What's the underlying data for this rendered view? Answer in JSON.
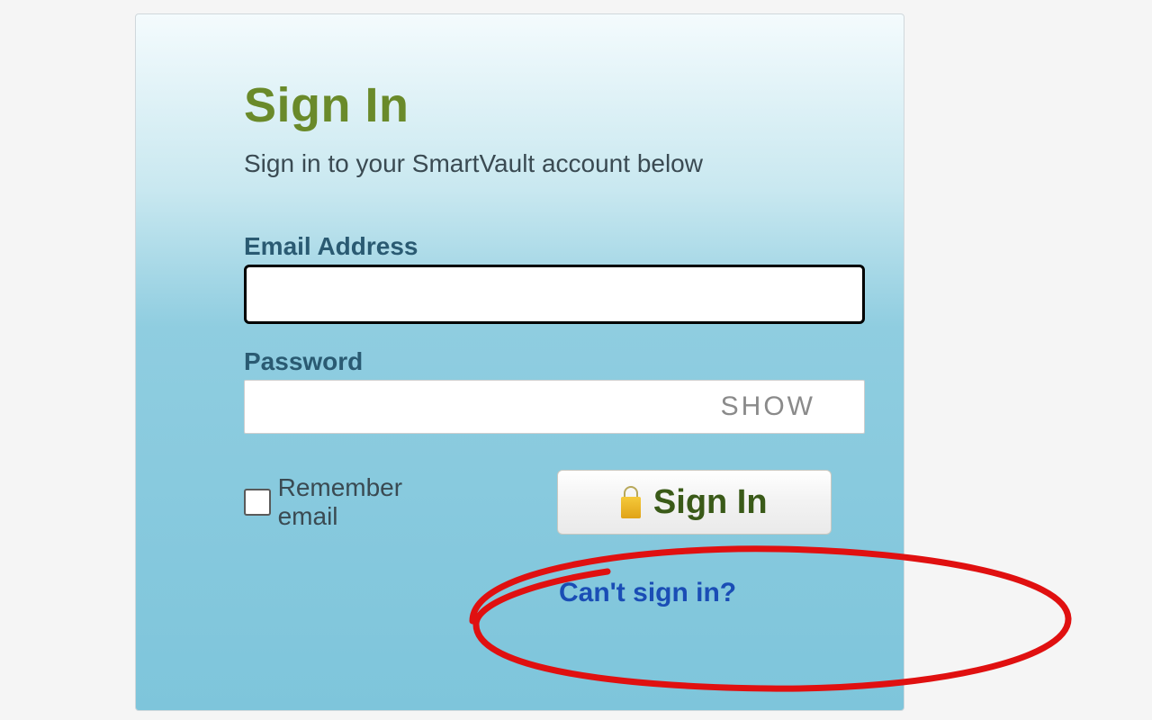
{
  "card": {
    "title": "Sign In",
    "subtitle": "Sign in to your SmartVault account below",
    "email_label": "Email Address",
    "email_value": "",
    "password_label": "Password",
    "password_value": "",
    "show_toggle": "SHOW",
    "remember_label": "Remember email",
    "signin_button_label": "Sign In",
    "cant_signin_link": "Can't sign in?"
  },
  "colors": {
    "accent_green": "#6a8a2a",
    "link_blue": "#1a4db5",
    "label_teal": "#2a5a72",
    "annotation_red": "#e01010"
  }
}
